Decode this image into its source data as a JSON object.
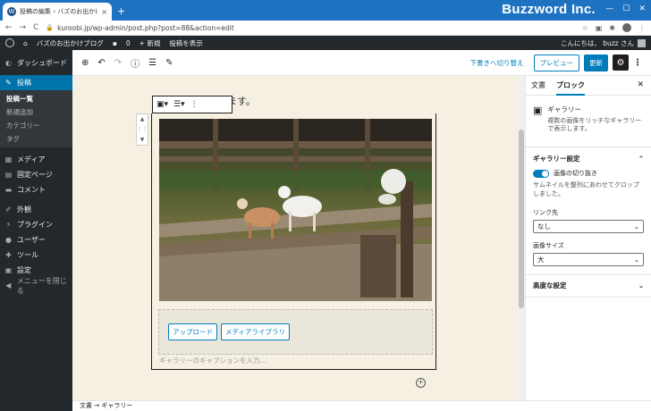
{
  "browser": {
    "tab_title": "投稿の編集 ‹ バズのお出かけブログ",
    "tab_close": "×",
    "new_tab": "+",
    "brand": "Buzzword Inc.",
    "window_buttons": [
      "—",
      "☐",
      "✕"
    ],
    "nav": [
      "←",
      "→",
      "C"
    ],
    "url": "kuroobi.jp/wp-admin/post.php?post=88&action=edit"
  },
  "adminbar": {
    "site_name": "バズのお出かけブログ",
    "comments": "0",
    "new": "新規",
    "view_post": "投稿を表示",
    "greeting": "こんにちは、 buzz さん"
  },
  "sidebar": {
    "dashboard": "ダッシュボード",
    "posts": "投稿",
    "sub": [
      "投稿一覧",
      "新規追加",
      "カテゴリー",
      "タグ"
    ],
    "media": "メディア",
    "pages": "固定ページ",
    "comments": "コメント",
    "appearance": "外観",
    "plugins": "プラグイン",
    "users": "ユーザー",
    "tools": "ツール",
    "settings": "設定",
    "collapse": "メニューを閉じる"
  },
  "toolbar": {
    "switch_draft": "下書きへ切り替え",
    "preview": "プレビュー",
    "update": "更新"
  },
  "editor": {
    "heading": "ここからはじめます。",
    "upload": "アップロード",
    "media_library": "メディアライブラリ",
    "caption_placeholder": "ギャラリーのキャプションを入力…"
  },
  "settings": {
    "tab_document": "文書",
    "tab_block": "ブロック",
    "block_title": "ギャラリー",
    "block_desc": "複数の画像をリッチなギャラリーで表示します。",
    "gallery_settings": "ギャラリー設定",
    "crop_label": "画像の切り抜き",
    "crop_help": "サムネイルを整列にあわせてクロップしました。",
    "link_label": "リンク先",
    "link_value": "なし",
    "size_label": "画像サイズ",
    "size_value": "大",
    "advanced": "高度な設定"
  },
  "footer": {
    "breadcrumb": "文書 → ギャラリー"
  }
}
